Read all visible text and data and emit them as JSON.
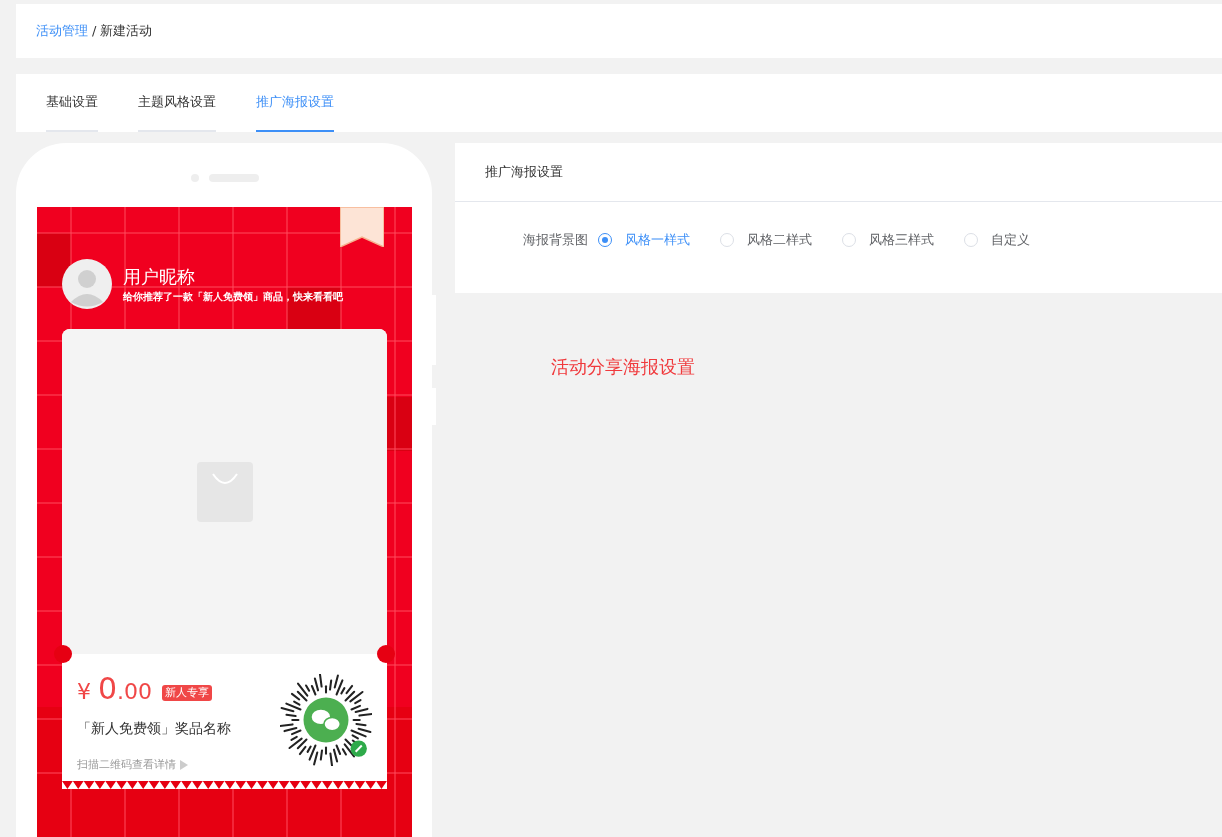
{
  "breadcrumb": [
    {
      "text": "活动管理",
      "link": true
    },
    {
      "text": "/",
      "link": false
    },
    {
      "text": "新建活动",
      "link": false
    }
  ],
  "tabs": [
    {
      "label": "基础设置",
      "selected": false
    },
    {
      "label": "主题风格设置",
      "selected": false
    },
    {
      "label": "推广海报设置",
      "selected": true
    }
  ],
  "poster": {
    "nickname": "用户昵称",
    "subtitle": "给你推荐了一款「新人免费领」商品，快来看看吧",
    "currency": "¥",
    "price_integer": "0",
    "price_decimal": ".00",
    "tag": "新人专享",
    "product_name": "「新人免费领」奖品名称",
    "hint": "扫描二维码查看详情"
  },
  "panel": {
    "title": "推广海报设置",
    "field_label": "海报背景图",
    "options": [
      {
        "label": "风格一样式",
        "selected": true
      },
      {
        "label": "风格二样式",
        "selected": false
      },
      {
        "label": "风格三样式",
        "selected": false
      },
      {
        "label": "自定义",
        "selected": false
      }
    ]
  },
  "note": "活动分享海报设置"
}
